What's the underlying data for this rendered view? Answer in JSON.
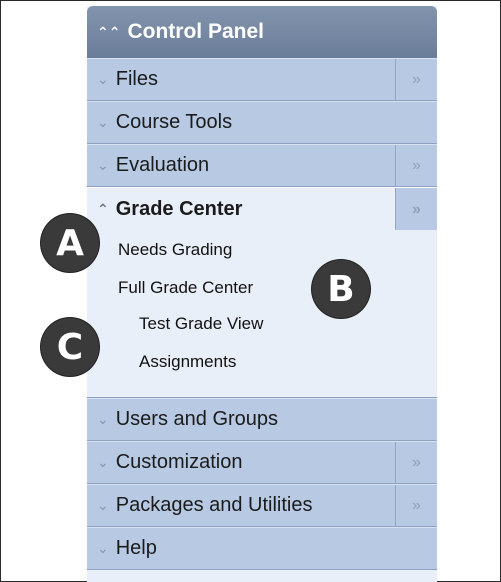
{
  "panel": {
    "title": "Control Panel",
    "items": [
      {
        "label": "Files",
        "expandable": true
      },
      {
        "label": "Course Tools",
        "expandable": false
      },
      {
        "label": "Evaluation",
        "expandable": true
      },
      {
        "label": "Grade Center",
        "expandable": true,
        "open": true
      },
      {
        "label": "Users and Groups",
        "expandable": false
      },
      {
        "label": "Customization",
        "expandable": true
      },
      {
        "label": "Packages and Utilities",
        "expandable": true
      },
      {
        "label": "Help",
        "expandable": false
      }
    ],
    "grade_center_links": [
      "Needs Grading",
      "Full Grade Center",
      "Test Grade View",
      "Assignments"
    ]
  },
  "callouts": [
    "A",
    "B",
    "C"
  ],
  "icons": {
    "collapse": "double-chevron-up-icon",
    "expand": "double-chevron-down-icon",
    "flyout": "double-chevron-right-icon"
  },
  "colors": {
    "header": "#6a7d99",
    "row": "#b7c9e3",
    "open_bg": "#e9eff8",
    "badge": "#3a3a3a"
  }
}
